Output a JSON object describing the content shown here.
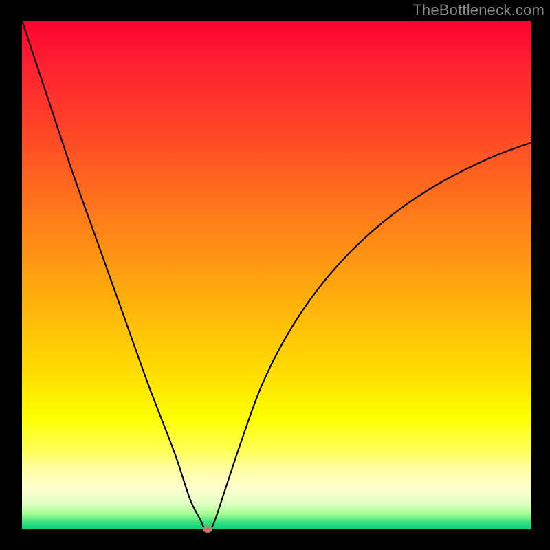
{
  "watermark": "TheBottleneck.com",
  "chart_data": {
    "type": "line",
    "title": "",
    "xlabel": "",
    "ylabel": "",
    "xlim": [
      0,
      100
    ],
    "ylim": [
      0,
      100
    ],
    "background_gradient": {
      "description": "vertical gradient from red (top, high bottleneck) through orange, yellow to green (bottom, no bottleneck)",
      "stops": [
        {
          "pos": 0,
          "color": "#ff0030"
        },
        {
          "pos": 50,
          "color": "#ffa010"
        },
        {
          "pos": 78,
          "color": "#ffff00"
        },
        {
          "pos": 100,
          "color": "#00d078"
        }
      ]
    },
    "series": [
      {
        "name": "bottleneck-curve",
        "x": [
          0,
          5,
          10,
          15,
          20,
          25,
          30,
          33,
          35,
          36,
          37,
          38,
          40,
          43,
          47,
          52,
          58,
          65,
          73,
          82,
          92,
          100
        ],
        "values": [
          100,
          85,
          70,
          56,
          42,
          28,
          15,
          6,
          2,
          0,
          0,
          2,
          8,
          17,
          28,
          38,
          47,
          55,
          62,
          68,
          73,
          76
        ]
      }
    ],
    "marker": {
      "name": "optimal-point",
      "x": 36.5,
      "y": 0,
      "color": "#c97568"
    },
    "grid": false,
    "legend": false
  }
}
